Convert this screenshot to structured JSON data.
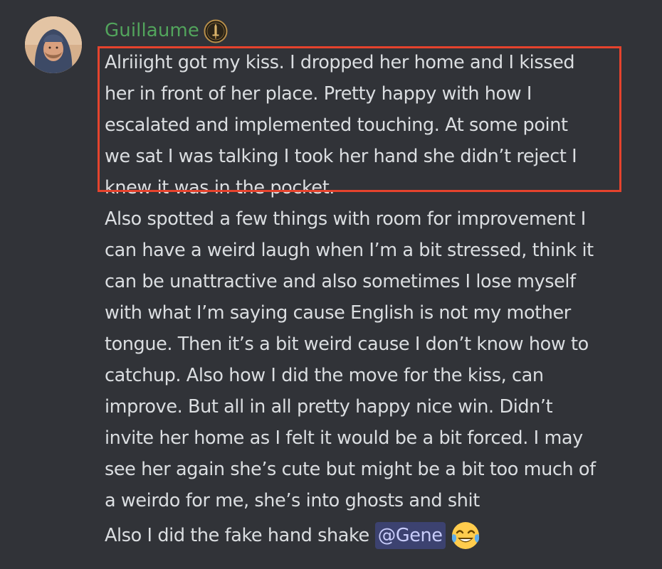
{
  "author": {
    "username": "Guillaume",
    "avatar_icon": "avatar",
    "role_icon": "sword-badge-icon"
  },
  "message": {
    "highlighted_lines": [
      "Alriiight got my kiss. I dropped her home and I kissed",
      "her in front of her place. Pretty happy with how I",
      "escalated and implemented touching. At some point",
      "we sat I was talking I took her hand she didn’t reject I",
      "knew it was in the pocket."
    ],
    "body_lines": [
      "Also spotted a few things with room for improvement I",
      "can have a weird laugh when I’m a bit stressed, think it",
      "can be unattractive and also sometimes I lose myself",
      "with what I’m saying cause English is not my mother",
      "tongue. Then it’s a bit weird cause I don’t know how to",
      "catchup. Also how I did the move for the kiss, can",
      "improve. But all in all pretty happy nice win. Didn’t",
      "invite her home as I felt it would be a bit forced. I may",
      "see her again she’s cute but might be a bit too much of",
      "a weirdo for me, she’s into ghosts and shit"
    ],
    "follow_up_text": "Also I did the fake hand shake",
    "mention": "@Gene",
    "emoji": "joy-emoji"
  },
  "colors": {
    "background": "#313338",
    "username": "#52a45c",
    "text": "#dbdee1",
    "highlight_border": "#e5432d",
    "mention_bg": "#3c4270",
    "mention_text": "#c9cdfb"
  }
}
